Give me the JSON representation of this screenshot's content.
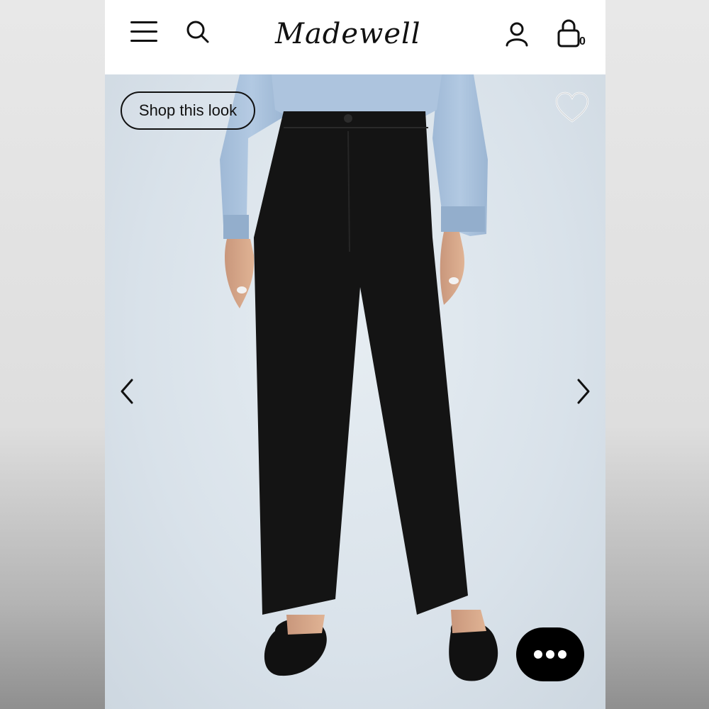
{
  "header": {
    "brand": "Madewell",
    "menu_icon": "hamburger-menu-icon",
    "search_icon": "search-icon",
    "account_icon": "user-account-icon",
    "bag_icon": "shopping-bag-icon",
    "bag_count": "0"
  },
  "hero": {
    "shop_this_look_label": "Shop this look",
    "favorite_icon": "heart-outline-icon",
    "prev_icon": "chevron-left-icon",
    "next_icon": "chevron-right-icon",
    "image_description": "product-photo"
  },
  "chat": {
    "icon": "chat-ellipsis-icon"
  },
  "colors": {
    "header_bg": "#ffffff",
    "hero_bg": "#dde5ec",
    "text": "#111111",
    "shirt": "#a9c2de",
    "jeans": "#141414"
  }
}
